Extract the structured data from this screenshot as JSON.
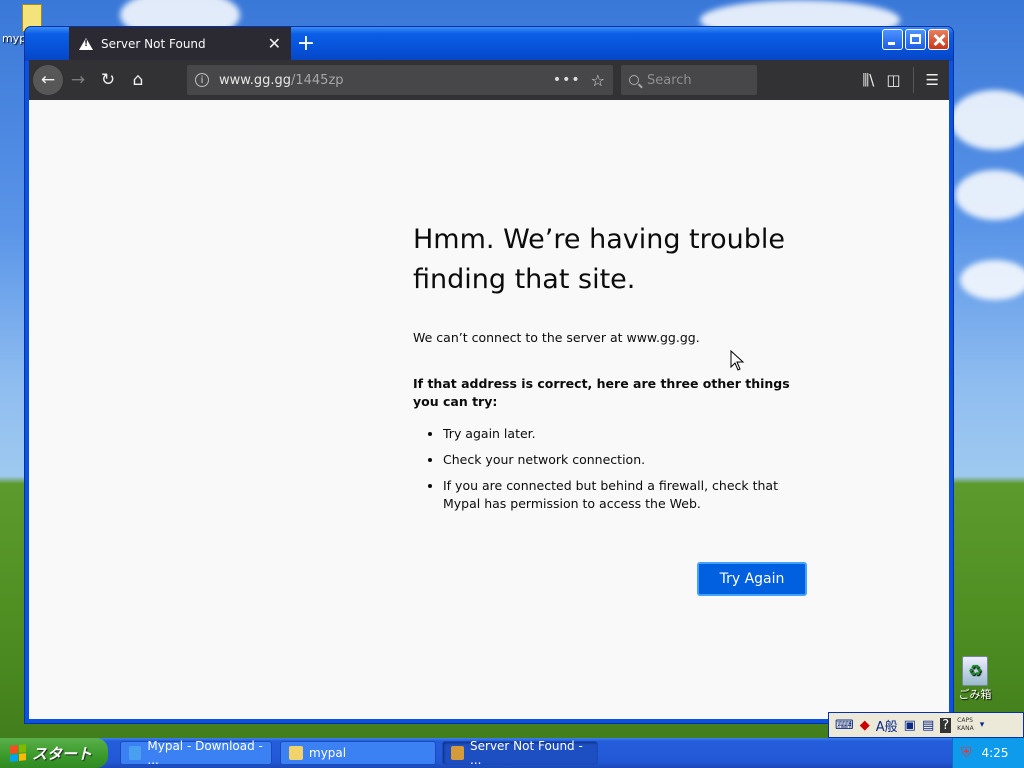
{
  "desktop": {
    "top_icon_label": "myp",
    "recycle_label": "ごみ箱"
  },
  "window": {
    "tab": {
      "title": "Server Not Found"
    },
    "url": {
      "host": "www.gg.gg",
      "path": "/1445zp"
    },
    "search": {
      "placeholder": "Search"
    }
  },
  "error": {
    "title": "Hmm. We’re having trouble finding that site.",
    "message": "We can’t connect to the server at www.gg.gg.",
    "subheading": "If that address is correct, here are three other things you can try:",
    "tips": [
      "Try again later.",
      "Check your network connection.",
      "If you are connected but behind a firewall, check that Mypal has permission to access the Web."
    ],
    "try_again_label": "Try Again"
  },
  "taskbar": {
    "start_label": "スタート",
    "items": [
      {
        "label": "Mypal - Download - ...",
        "icon": "ie-icon"
      },
      {
        "label": "mypal",
        "icon": "folder-icon"
      },
      {
        "label": "Server Not Found - ...",
        "icon": "mypal-icon"
      }
    ],
    "clock": "4:25",
    "ime_mode": "A般",
    "caps": "CAPS",
    "kana": "KANA"
  }
}
